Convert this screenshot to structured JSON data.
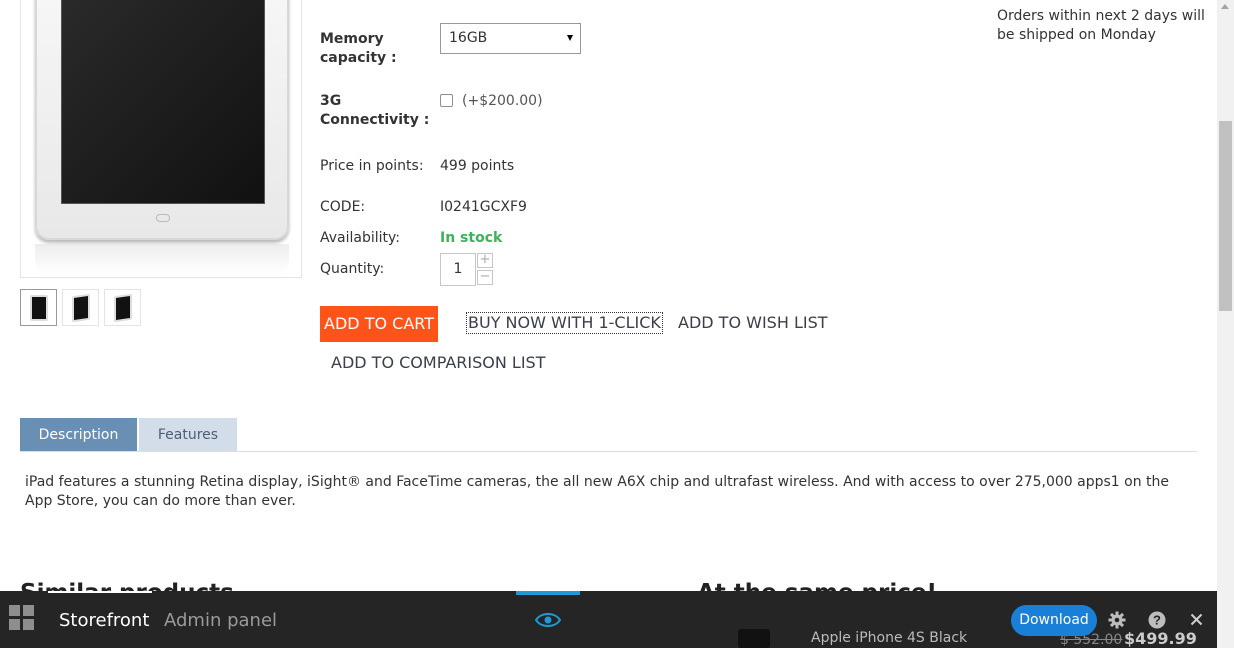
{
  "product": {
    "options": {
      "memory_label": "Memory capacity :",
      "memory_value": "16GB",
      "connectivity_label": "3G Connectivity :",
      "connectivity_price": "(+$200.00)"
    },
    "points_label": "Price in points:",
    "points_value": "499 points",
    "code_label": "CODE:",
    "code_value": "I0241GCXF9",
    "availability_label": "Availability:",
    "availability_value": "In stock",
    "quantity_label": "Quantity:",
    "quantity_value": "1",
    "plus": "+",
    "minus": "−",
    "add_to_cart": "ADD TO CART",
    "buy_now": "BUY NOW WITH 1-CLICK",
    "wish_list": "ADD TO WISH LIST",
    "comparison": "ADD TO COMPARISON LIST"
  },
  "shipping": {
    "note": "Orders within next 2 days will be shipped on Monday"
  },
  "tabs": {
    "description": "Description",
    "features": "Features"
  },
  "description_text": "iPad features a stunning Retina display, iSight® and FaceTime cameras, the all new A6X chip and ultrafast wireless. And with access to over 275,000 apps1 on the App Store, you can do more than ever.",
  "sections": {
    "similar": "Similar products",
    "same_price": "At the same price!"
  },
  "peek": {
    "product_name": "Apple iPhone 4S Black",
    "old_price": "$ 552.00",
    "price": "$499.99"
  },
  "toolbar": {
    "storefront": "Storefront",
    "admin": "Admin panel",
    "download": "Download"
  },
  "colors": {
    "accent": "#ff5319",
    "in_stock": "#3ab457",
    "tab_active": "#6a8fb4",
    "download": "#1a7fd6"
  }
}
